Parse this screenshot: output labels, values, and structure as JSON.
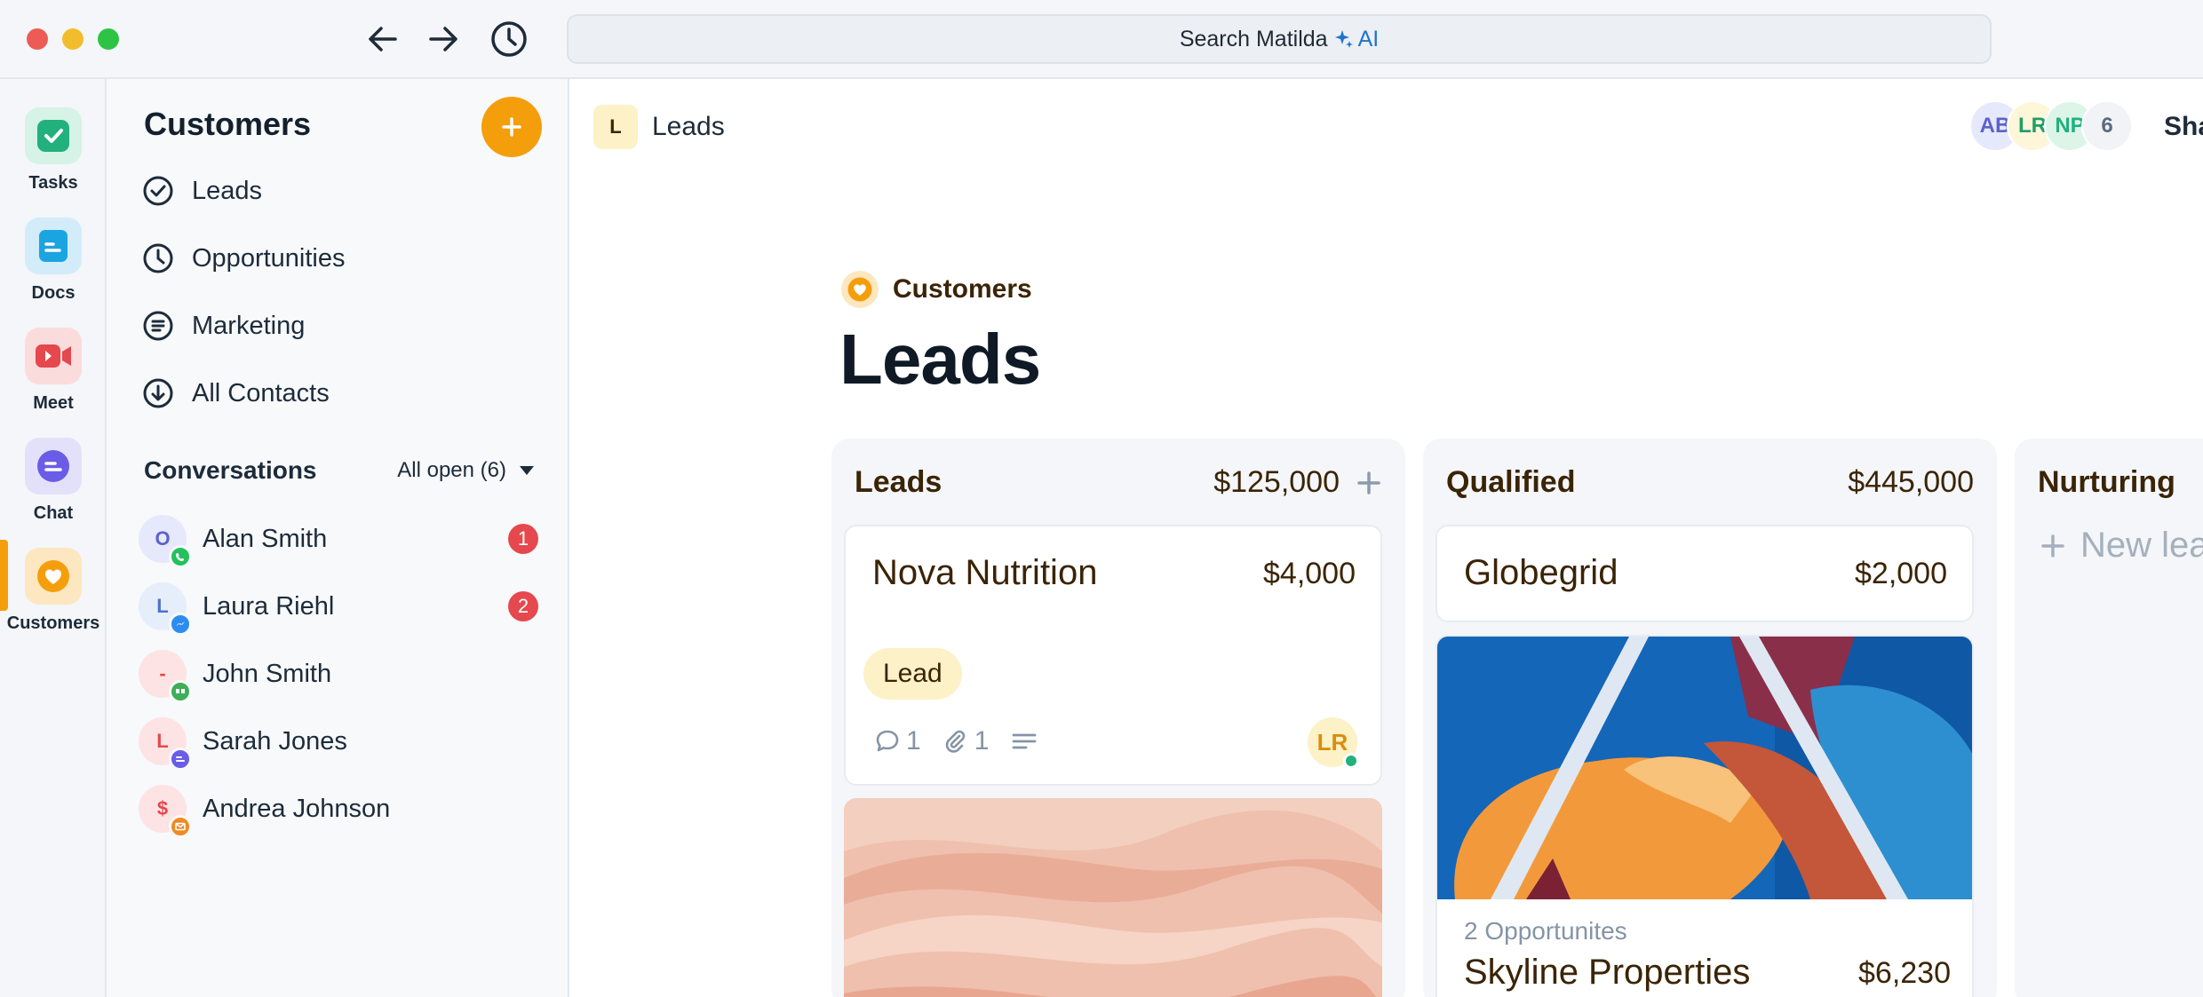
{
  "window": {
    "search_label": "Search Matilda",
    "search_ai_label": "AI"
  },
  "rail": {
    "items": [
      {
        "label": "Tasks",
        "icon": "check-square-icon",
        "color": "#22b07d"
      },
      {
        "label": "Docs",
        "icon": "doc-icon",
        "color": "#1ba5e0"
      },
      {
        "label": "Meet",
        "icon": "video-icon",
        "color": "#e5484d"
      },
      {
        "label": "Chat",
        "icon": "chat-icon",
        "color": "#6b5ce7"
      },
      {
        "label": "Customers",
        "icon": "heart-icon",
        "color": "#f59e0b"
      }
    ],
    "active": "Customers"
  },
  "sidebar": {
    "title": "Customers",
    "nav": [
      {
        "label": "Leads",
        "icon": "check-circle-icon"
      },
      {
        "label": "Opportunities",
        "icon": "clock-icon"
      },
      {
        "label": "Marketing",
        "icon": "list-circle-icon"
      },
      {
        "label": "All Contacts",
        "icon": "arrow-down-circle-icon"
      }
    ],
    "conversations": {
      "title": "Conversations",
      "filter": "All open (6)",
      "items": [
        {
          "initial": "O",
          "name": "Alan Smith",
          "channel": "whatsapp-icon",
          "unread": "1"
        },
        {
          "initial": "L",
          "name": "Laura Riehl",
          "channel": "messenger-icon",
          "unread": "2"
        },
        {
          "initial": "-",
          "name": "John Smith",
          "channel": "quote-icon",
          "unread": ""
        },
        {
          "initial": "L",
          "name": "Sarah Jones",
          "channel": "chat-icon",
          "unread": ""
        },
        {
          "initial": "$",
          "name": "Andrea Johnson",
          "channel": "mail-icon",
          "unread": ""
        }
      ]
    }
  },
  "main": {
    "breadcrumb": {
      "badge": "L",
      "label": "Leads"
    },
    "collaborators": [
      "AB",
      "LR",
      "NP",
      "6"
    ],
    "share_label": "Sha",
    "kicker": "Customers",
    "title": "Leads",
    "columns": [
      {
        "name": "Leads",
        "total": "$125,000",
        "cards": [
          {
            "title": "Nova Nutrition",
            "amount": "$4,000",
            "tag": "Lead",
            "comments": "1",
            "attachments": "1",
            "owner": "LR"
          }
        ]
      },
      {
        "name": "Qualified",
        "total": "$445,000",
        "cards": [
          {
            "title": "Globegrid",
            "amount": "$2,000"
          },
          {
            "subtitle": "2 Opportunites",
            "title": "Skyline Properties",
            "amount": "$6,230"
          }
        ]
      },
      {
        "name": "Nurturing",
        "new_label": "New lea"
      }
    ]
  },
  "colors": {
    "accent": "#f59e0b",
    "danger": "#e5484d",
    "online": "#22b07d"
  }
}
